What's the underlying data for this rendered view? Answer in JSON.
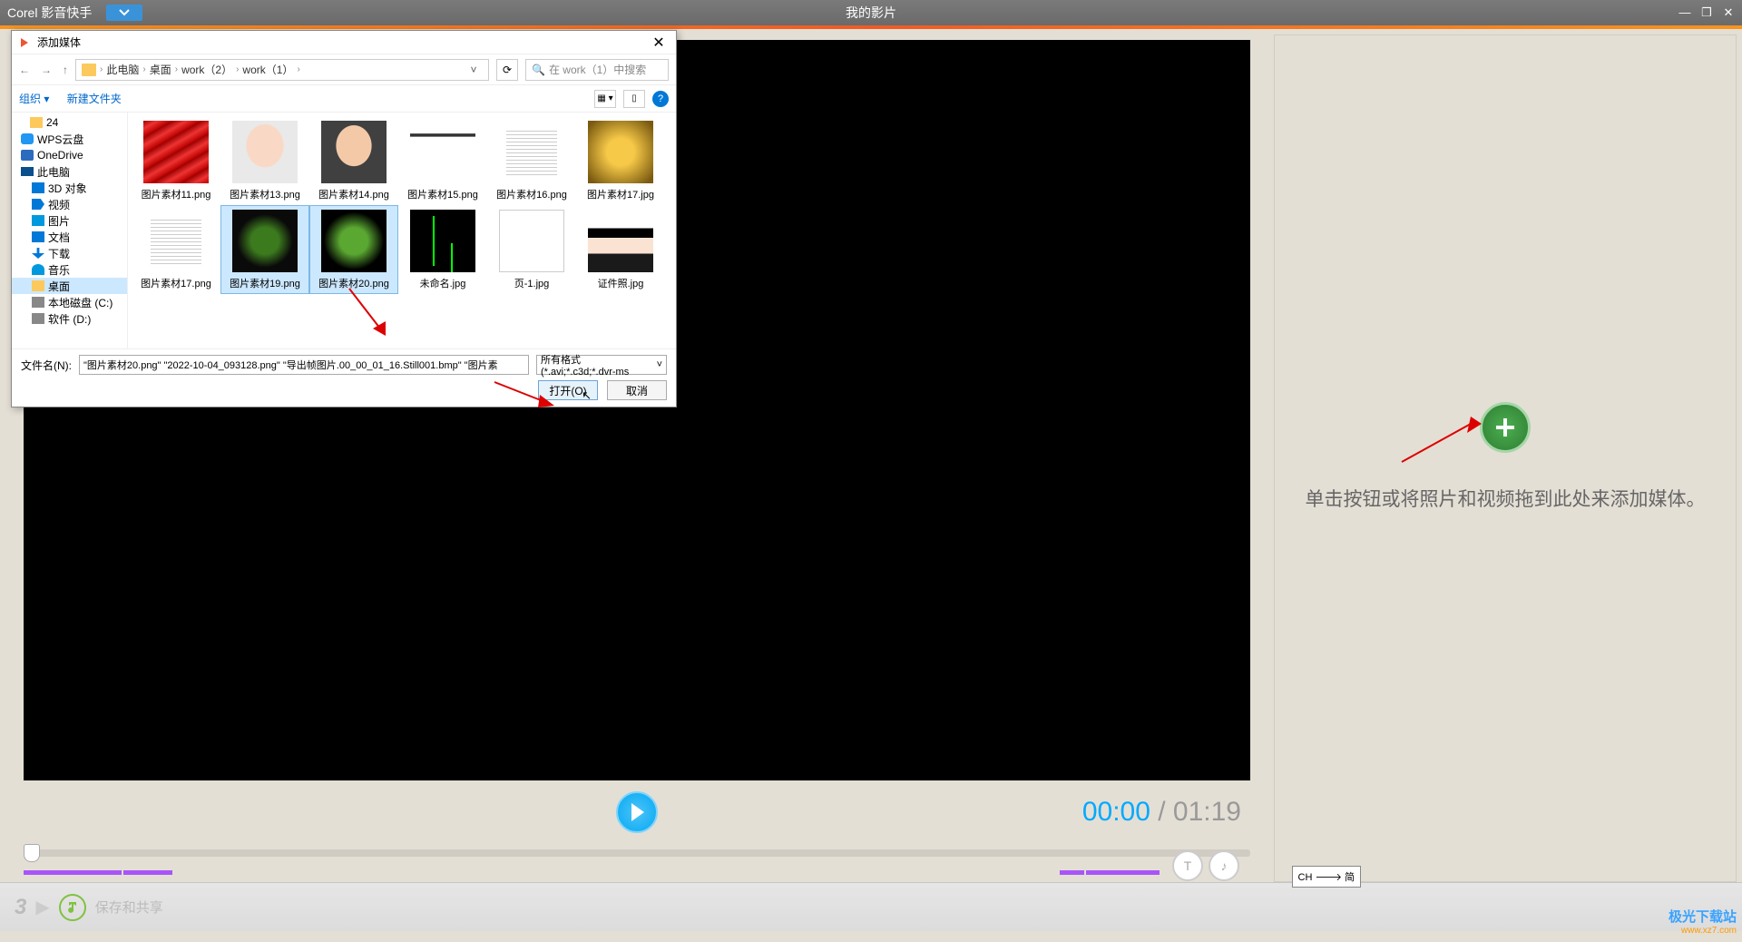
{
  "titlebar": {
    "app_name": "Corel 影音快手",
    "project_title": "我的影片"
  },
  "right_panel": {
    "hint": "单击按钮或将照片和视频拖到此处来添加媒体。"
  },
  "time": {
    "current": "00:00",
    "sep": " / ",
    "total": "01:19"
  },
  "bottom": {
    "step_num": "3",
    "step_label": "保存和共享"
  },
  "ime": "CH 🡒 简",
  "watermark": {
    "brand": "极光下载站",
    "url": "www.xz7.com"
  },
  "file_dialog": {
    "title": "添加媒体",
    "breadcrumb": [
      "此电脑",
      "桌面",
      "work（2）",
      "work（1）"
    ],
    "search_placeholder": "在 work（1）中搜索",
    "toolbar": {
      "organize": "组织 ▾",
      "new_folder": "新建文件夹"
    },
    "tree": [
      {
        "label": "24",
        "cls": "folder",
        "indent": 20
      },
      {
        "label": "WPS云盘",
        "cls": "cloud",
        "indent": 10
      },
      {
        "label": "OneDrive",
        "cls": "onedrive",
        "indent": 10
      },
      {
        "label": "此电脑",
        "cls": "pc",
        "indent": 10
      },
      {
        "label": "3D 对象",
        "cls": "blue3d",
        "indent": 22
      },
      {
        "label": "视频",
        "cls": "video",
        "indent": 22
      },
      {
        "label": "图片",
        "cls": "pic",
        "indent": 22
      },
      {
        "label": "文档",
        "cls": "doc",
        "indent": 22
      },
      {
        "label": "下载",
        "cls": "dl",
        "indent": 22
      },
      {
        "label": "音乐",
        "cls": "music",
        "indent": 22
      },
      {
        "label": "桌面",
        "cls": "folder",
        "indent": 22,
        "selected": true
      },
      {
        "label": "本地磁盘 (C:)",
        "cls": "disk",
        "indent": 22
      },
      {
        "label": "软件 (D:)",
        "cls": "disk",
        "indent": 22
      }
    ],
    "files": [
      {
        "label": "图片素材11.png",
        "th": "th-red"
      },
      {
        "label": "图片素材13.png",
        "th": "th-face1"
      },
      {
        "label": "图片素材14.png",
        "th": "th-face2"
      },
      {
        "label": "图片素材15.png",
        "th": "th-person"
      },
      {
        "label": "图片素材16.png",
        "th": "th-text"
      },
      {
        "label": "图片素材17.jpg",
        "th": "th-yellow"
      },
      {
        "label": "图片素材17.png",
        "th": "th-text"
      },
      {
        "label": "图片素材19.png",
        "th": "th-leaf1",
        "selected": true
      },
      {
        "label": "图片素材20.png",
        "th": "th-leaf2",
        "selected": true
      },
      {
        "label": "未命名.jpg",
        "th": "th-axis"
      },
      {
        "label": "页-1.jpg",
        "th": "th-page"
      },
      {
        "label": "证件照.jpg",
        "th": "th-idphoto"
      },
      {
        "label": "",
        "th": "th-grid"
      }
    ],
    "filename_label": "文件名(N):",
    "filename_value": "\"图片素材20.png\" \"2022-10-04_093128.png\" \"导出帧图片.00_00_01_16.Still001.bmp\" \"图片素",
    "filter": "所有格式 (*.avi;*.c3d;*.dvr-ms",
    "open_btn": "打开(O)",
    "cancel_btn": "取消"
  }
}
